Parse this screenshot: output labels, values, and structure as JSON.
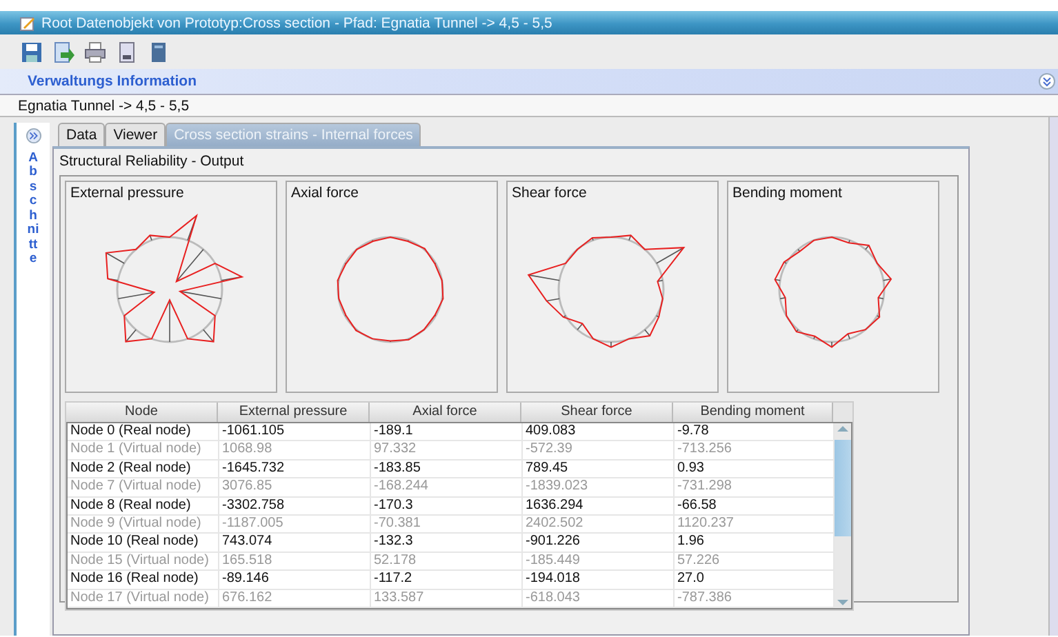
{
  "window": {
    "title": "Root Datenobjekt von Prototyp:Cross section - Pfad: Egnatia Tunnel -> 4,5 - 5,5"
  },
  "section_header": {
    "title": "Verwaltungs Information"
  },
  "path": "Egnatia Tunnel -> 4,5 - 5,5",
  "sidebar": {
    "label": "Abschnitte"
  },
  "tabs": [
    {
      "label": "Data",
      "selected": false
    },
    {
      "label": "Viewer",
      "selected": false
    },
    {
      "label": "Cross section strains - Internal forces",
      "selected": true
    }
  ],
  "panel": {
    "title": "Structural Reliability - Output"
  },
  "diagrams": [
    {
      "title": "External pressure"
    },
    {
      "title": "Axial force"
    },
    {
      "title": "Shear force"
    },
    {
      "title": "Bending moment"
    }
  ],
  "table": {
    "columns": [
      "Node",
      "External pressure",
      "Axial force",
      "Shear force",
      "Bending moment"
    ],
    "rows": [
      {
        "kind": "real",
        "cells": [
          "Node 0 (Real node)",
          "-1061.105",
          "-189.1",
          "409.083",
          "-9.78"
        ]
      },
      {
        "kind": "virtual",
        "cells": [
          "Node 1 (Virtual node)",
          "1068.98",
          "97.332",
          "-572.39",
          "-713.256"
        ]
      },
      {
        "kind": "real",
        "cells": [
          "Node 2 (Real node)",
          "-1645.732",
          "-183.85",
          "789.45",
          "0.93"
        ]
      },
      {
        "kind": "virtual",
        "cells": [
          "Node 7 (Virtual node)",
          "3076.85",
          "-168.244",
          "-1839.023",
          "-731.298"
        ]
      },
      {
        "kind": "real",
        "cells": [
          "Node 8 (Real node)",
          "-3302.758",
          "-170.3",
          "1636.294",
          "-66.58"
        ]
      },
      {
        "kind": "virtual",
        "cells": [
          "Node 9 (Virtual node)",
          "-1187.005",
          "-70.381",
          "2402.502",
          "1120.237"
        ]
      },
      {
        "kind": "real",
        "cells": [
          "Node 10 (Real node)",
          "743.074",
          "-132.3",
          "-901.226",
          "1.96"
        ]
      },
      {
        "kind": "virtual",
        "cells": [
          "Node 15 (Virtual node)",
          "165.518",
          "52.178",
          "-185.449",
          "57.226"
        ]
      },
      {
        "kind": "real",
        "cells": [
          "Node 16 (Real node)",
          "-89.146",
          "-117.2",
          "-194.018",
          "27.0"
        ]
      },
      {
        "kind": "virtual",
        "cells": [
          "Node 17 (Virtual node)",
          "676.162",
          "133.587",
          "-618.043",
          "-787.386"
        ]
      }
    ]
  }
}
